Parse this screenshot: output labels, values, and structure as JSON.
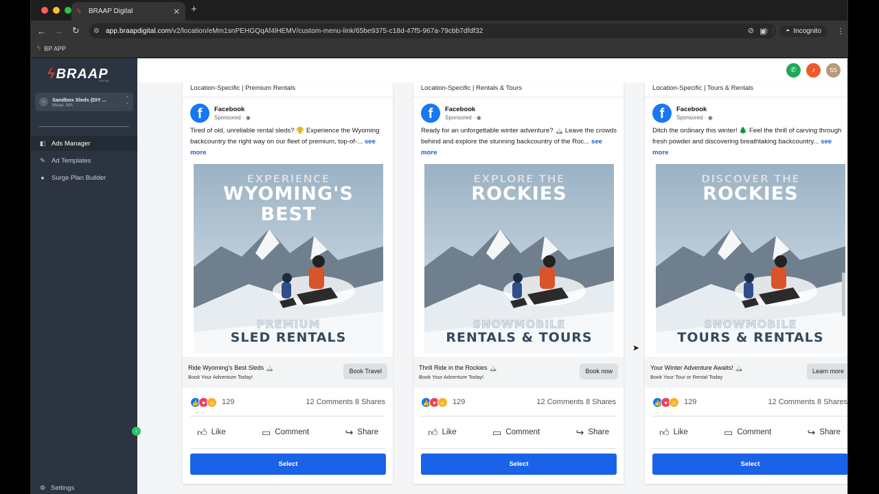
{
  "browser": {
    "tab_title": "BRAAP Digital",
    "url_host": "app.braapdigital.com",
    "url_path": "/v2/location/eMm1snPEHGQqAf4lHEMV/custom-menu-link/65be9375-c18d-47f5-967a-79cbb7dfdf32",
    "incognito_label": "Incognito",
    "bookmark_label": "BP APP"
  },
  "sidebar": {
    "logo_text": "BRAAP",
    "logo_sub": "DIGITAL",
    "account_name": "Sandbox Sleds (DIY ...",
    "account_location": "Mead, WA",
    "items": [
      {
        "label": "Ads Manager",
        "icon": "megaphone-icon",
        "active": true
      },
      {
        "label": "Ad Templates",
        "icon": "pencil-icon",
        "active": false
      },
      {
        "label": "Surge Plan Builder",
        "icon": "chat-icon",
        "active": false
      }
    ],
    "settings_label": "Settings"
  },
  "topbar": {
    "avatar_initials": "SS",
    "colors": {
      "phone": "#1fa855",
      "bell": "#f0592a",
      "avatar": "#b89a76"
    }
  },
  "cards": [
    {
      "header": "Location-Specific | Premium Rentals",
      "page_name": "Facebook",
      "sponsored": "Sponsored · ",
      "body": "Tired of old, unreliable rental sleds? 😤 Experience the Wyoming backcountry the right way on our fleet of premium, top-of-...",
      "see_more": "see more",
      "img_line1": "EXPERIENCE",
      "img_line2": "WYOMING'S",
      "img_line3": "BEST",
      "img_bottom1": "PREMIUM",
      "img_bottom2": "SLED RENTALS",
      "cta_title": "Ride Wyoming's Best Sleds 🏔️",
      "cta_sub": "Book Your Adventure Today!",
      "cta_button": "Book Travel",
      "reactions": "129",
      "comments_shares": "12 Comments  8 Shares",
      "like": "Like",
      "comment": "Comment",
      "share": "Share",
      "select": "Select"
    },
    {
      "header": "Location-Specific | Rentals & Tours",
      "page_name": "Facebook",
      "sponsored": "Sponsored · ",
      "body": "Ready for an unforgettable winter adventure? 🏔️ Leave the crowds behind and explore the stunning backcountry of the Roc...",
      "see_more": "see more",
      "img_line1": "EXPLORE THE",
      "img_line2": "ROCKIES",
      "img_line3": "",
      "img_bottom1": "SNOWMOBILE",
      "img_bottom2": "RENTALS & TOURS",
      "cta_title": "Thrill Ride in the Rockies 🏔️",
      "cta_sub": "Book Your Adventure Today!",
      "cta_button": "Book now",
      "reactions": "129",
      "comments_shares": "12 Comments  8 Shares",
      "like": "Like",
      "comment": "Comment",
      "share": "Share",
      "select": "Select"
    },
    {
      "header": "Location-Specific | Tours & Rentals",
      "page_name": "Facebook",
      "sponsored": "Sponsored · ",
      "body": "Ditch the ordinary this winter! 🌲 Feel the thrill of carving through fresh powder and discovering breathtaking backcountry...",
      "see_more": "see more",
      "img_line1": "DISCOVER THE",
      "img_line2": "ROCKIES",
      "img_line3": "",
      "img_bottom1": "SNOWMOBILE",
      "img_bottom2": "TOURS & RENTALS",
      "cta_title": "Your Winter Adventure Awaits! 🏔️",
      "cta_sub": "Book Your Tour or Rental Today",
      "cta_button": "Learn more",
      "reactions": "129",
      "comments_shares": "12 Comments  8 Shares",
      "like": "Like",
      "comment": "Comment",
      "share": "Share",
      "select": "Select"
    }
  ],
  "colors": {
    "select_button": "#1a63e8",
    "facebook_blue": "#1877f2",
    "sidebar_bg": "#2b3440"
  }
}
